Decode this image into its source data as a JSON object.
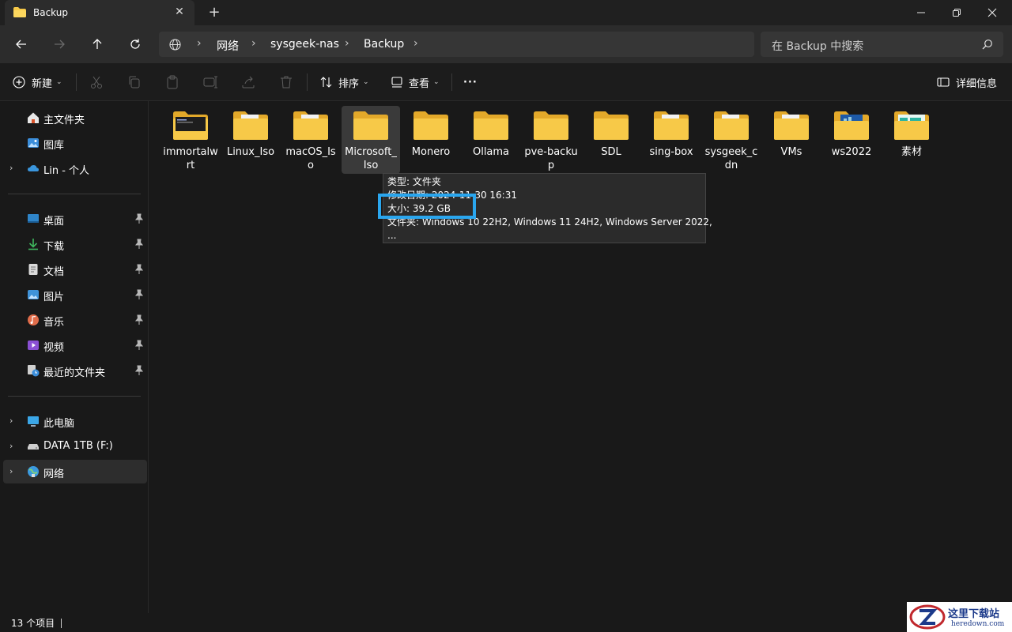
{
  "window": {
    "tab_title": "Backup",
    "tab_close": "✕",
    "new_tab": "+"
  },
  "address": {
    "crumbs": [
      "网络",
      "sysgeek-nas",
      "Backup"
    ],
    "search_placeholder": "在 Backup 中搜索"
  },
  "commands": {
    "new": "新建",
    "sort": "排序",
    "view": "查看",
    "more": "···",
    "details": "详细信息"
  },
  "sidebar": {
    "items": [
      {
        "label": "主文件夹",
        "icon": "home-icon"
      },
      {
        "label": "图库",
        "icon": "gallery-icon"
      },
      {
        "label": "Lin - 个人",
        "icon": "onedrive-icon"
      },
      {
        "label": "桌面",
        "icon": "desktop-icon"
      },
      {
        "label": "下载",
        "icon": "download-icon"
      },
      {
        "label": "文档",
        "icon": "documents-icon"
      },
      {
        "label": "图片",
        "icon": "pictures-icon"
      },
      {
        "label": "音乐",
        "icon": "music-icon"
      },
      {
        "label": "视频",
        "icon": "videos-icon"
      },
      {
        "label": "最近的文件夹",
        "icon": "recent-folders-icon"
      },
      {
        "label": "此电脑",
        "icon": "this-pc-icon"
      },
      {
        "label": "DATA 1TB (F:)",
        "icon": "drive-icon"
      },
      {
        "label": "网络",
        "icon": "network-icon"
      }
    ]
  },
  "files": [
    {
      "name": "immortalwrt",
      "line1": "immortalw",
      "line2": "rt",
      "variant": "dark"
    },
    {
      "name": "Linux_Iso",
      "line1": "Linux_Iso",
      "line2": "",
      "variant": "doc"
    },
    {
      "name": "macOS_Iso",
      "line1": "macOS_Is",
      "line2": "o",
      "variant": "doc"
    },
    {
      "name": "Microsoft_Iso",
      "line1": "Microsoft_",
      "line2": "Iso",
      "variant": "plain"
    },
    {
      "name": "Monero",
      "line1": "Monero",
      "line2": "",
      "variant": "plain"
    },
    {
      "name": "Ollama",
      "line1": "Ollama",
      "line2": "",
      "variant": "plain"
    },
    {
      "name": "pve-backup",
      "line1": "pve-backu",
      "line2": "p",
      "variant": "plain"
    },
    {
      "name": "SDL",
      "line1": "SDL",
      "line2": "",
      "variant": "plain"
    },
    {
      "name": "sing-box",
      "line1": "sing-box",
      "line2": "",
      "variant": "doc"
    },
    {
      "name": "sysgeek_cdn",
      "line1": "sysgeek_c",
      "line2": "dn",
      "variant": "doc"
    },
    {
      "name": "VMs",
      "line1": "VMs",
      "line2": "",
      "variant": "doc"
    },
    {
      "name": "ws2022",
      "line1": "ws2022",
      "line2": "",
      "variant": "blue"
    },
    {
      "name": "素材",
      "line1": "素材",
      "line2": "",
      "variant": "cyan"
    }
  ],
  "tooltip": {
    "type": "类型: 文件夹",
    "modified": "修改日期: 2024-11-30 16:31",
    "size": "大小: 39.2 GB",
    "contents": "文件夹: Windows 10 22H2, Windows 11 24H2, Windows Server 2022,",
    "ellipsis": "..."
  },
  "status": {
    "count": "13 个项目"
  },
  "watermark": {
    "text": "这里下载站",
    "sub": "heredown.com"
  },
  "colors": {
    "folder": "#f7c948",
    "folder_dark": "#e3a92a",
    "highlight": "#2aa6ee",
    "background": "#191919"
  }
}
